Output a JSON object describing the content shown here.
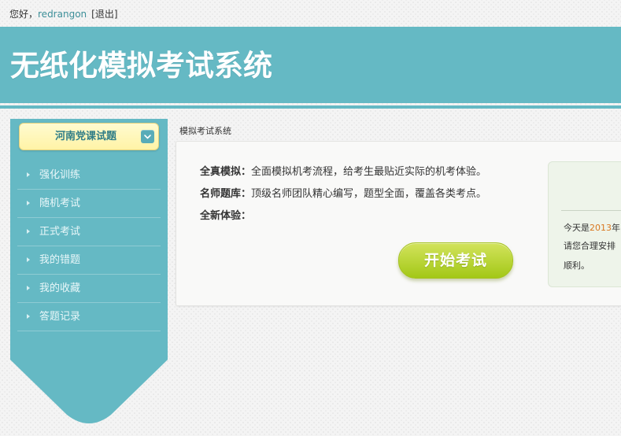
{
  "topbar": {
    "greeting": "您好，",
    "username": "redrangon",
    "logout": "[退出]"
  },
  "header": {
    "title": "无纸化模拟考试系统"
  },
  "sidebar": {
    "course_select": "河南党课试题",
    "menu": [
      {
        "label": "强化训练"
      },
      {
        "label": "随机考试"
      },
      {
        "label": "正式考试"
      },
      {
        "label": "我的错题"
      },
      {
        "label": "我的收藏"
      },
      {
        "label": "答题记录"
      }
    ]
  },
  "main": {
    "breadcrumb": "模拟考试系统",
    "features": [
      {
        "title": "全真模拟：",
        "desc": "全面模拟机考流程，给考生最贴近实际的机考体验。"
      },
      {
        "title": "名师题库：",
        "desc": "顶级名师团队精心编写，题型全面，覆盖各类考点。"
      },
      {
        "title": "全新体验：",
        "desc": ""
      }
    ],
    "start_button": "开始考试",
    "info": {
      "line1_prefix": "今天是",
      "year": "2013",
      "line1_suffix": "年",
      "line2": "请您合理安排",
      "line3": "顺利。"
    }
  },
  "colors": {
    "header": "#65b9c4",
    "sidebar": "#65b9c4",
    "select_bg": "#fff6b3",
    "start_button": "#b5d431",
    "year_highlight": "#d9771f"
  },
  "icons": {
    "dropdown": "chevron-down-icon",
    "menu_arrow": "triangle-right-icon"
  }
}
